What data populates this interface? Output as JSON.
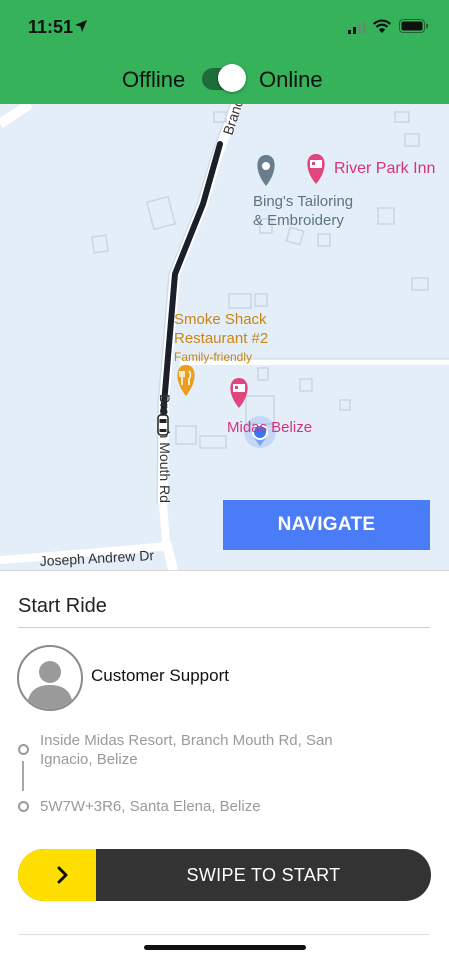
{
  "status_bar": {
    "time": "11:51"
  },
  "availability": {
    "offline_label": "Offline",
    "online_label": "Online",
    "is_online": true
  },
  "map": {
    "road_branch": "Branch Mouth Rd",
    "road_branch_top": "Branc",
    "road_joseph": "Joseph Andrew Dr",
    "pois": [
      {
        "name": "River Park Inn",
        "color": "#d6337a",
        "icon": "hotel-icon"
      },
      {
        "name": "Bing's Tailoring\n& Embroidery",
        "color": "#5f7381",
        "icon": "place-pin-icon"
      },
      {
        "name": "Smoke Shack\nRestaurant #2",
        "sub": "Family-friendly",
        "color": "#c98515",
        "icon": "restaurant-icon"
      },
      {
        "name": "Midas Belize",
        "color": "#d6337a",
        "icon": "hotel-icon"
      }
    ],
    "navigate_label": "NAVIGATE"
  },
  "ride": {
    "title": "Start Ride",
    "customer_name": "Customer Support",
    "pickup_address": "Inside Midas Resort, Branch Mouth Rd, San Ignacio, Belize",
    "dropoff_address": "5W7W+3R6, Santa Elena, Belize",
    "swipe_label": "SWIPE TO START"
  },
  "colors": {
    "header": "#35b25a",
    "navigate": "#4a7cf7",
    "swipe_handle": "#ffdf00",
    "swipe_track": "#333333"
  }
}
